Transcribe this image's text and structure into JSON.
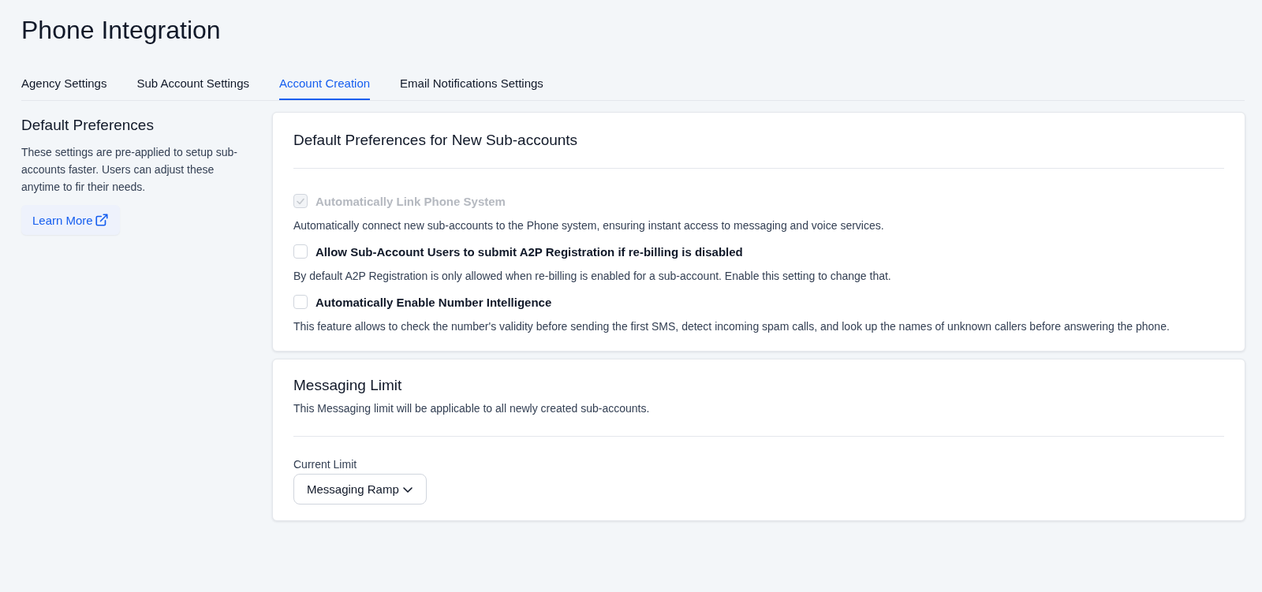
{
  "page": {
    "title": "Phone Integration"
  },
  "tabs": [
    {
      "label": "Agency Settings",
      "selected": false
    },
    {
      "label": "Sub Account Settings",
      "selected": false
    },
    {
      "label": "Account Creation",
      "selected": true
    },
    {
      "label": "Email Notifications Settings",
      "selected": false
    }
  ],
  "sidebar": {
    "heading": "Default Preferences",
    "description": "These settings are pre-applied to setup sub-accounts faster. Users can adjust these anytime to fir their needs.",
    "link": "Learn More"
  },
  "preferences_card": {
    "title": "Default Preferences for New Sub-accounts",
    "options": [
      {
        "label": "Automatically Link Phone System",
        "checked": true,
        "disabled": true,
        "description": "Automatically connect new sub-accounts to the Phone system, ensuring instant access to messaging and voice services."
      },
      {
        "label": "Allow Sub-Account Users to submit A2P Registration if re-billing is disabled",
        "checked": false,
        "disabled": false,
        "description": "By default A2P Registration is only allowed when re-billing is enabled for a sub-account. Enable this setting to change that."
      },
      {
        "label": "Automatically Enable Number Intelligence",
        "checked": false,
        "disabled": false,
        "description": "This feature allows to check the number's validity before sending the first SMS, detect incoming spam calls, and look up the names of unknown callers before answering the phone."
      }
    ]
  },
  "messaging_card": {
    "title": "Messaging Limit",
    "description": "This Messaging limit will be applicable to all newly created sub-accounts.",
    "field_label": "Current Limit",
    "dropdown_value": "Messaging Ramp"
  }
}
